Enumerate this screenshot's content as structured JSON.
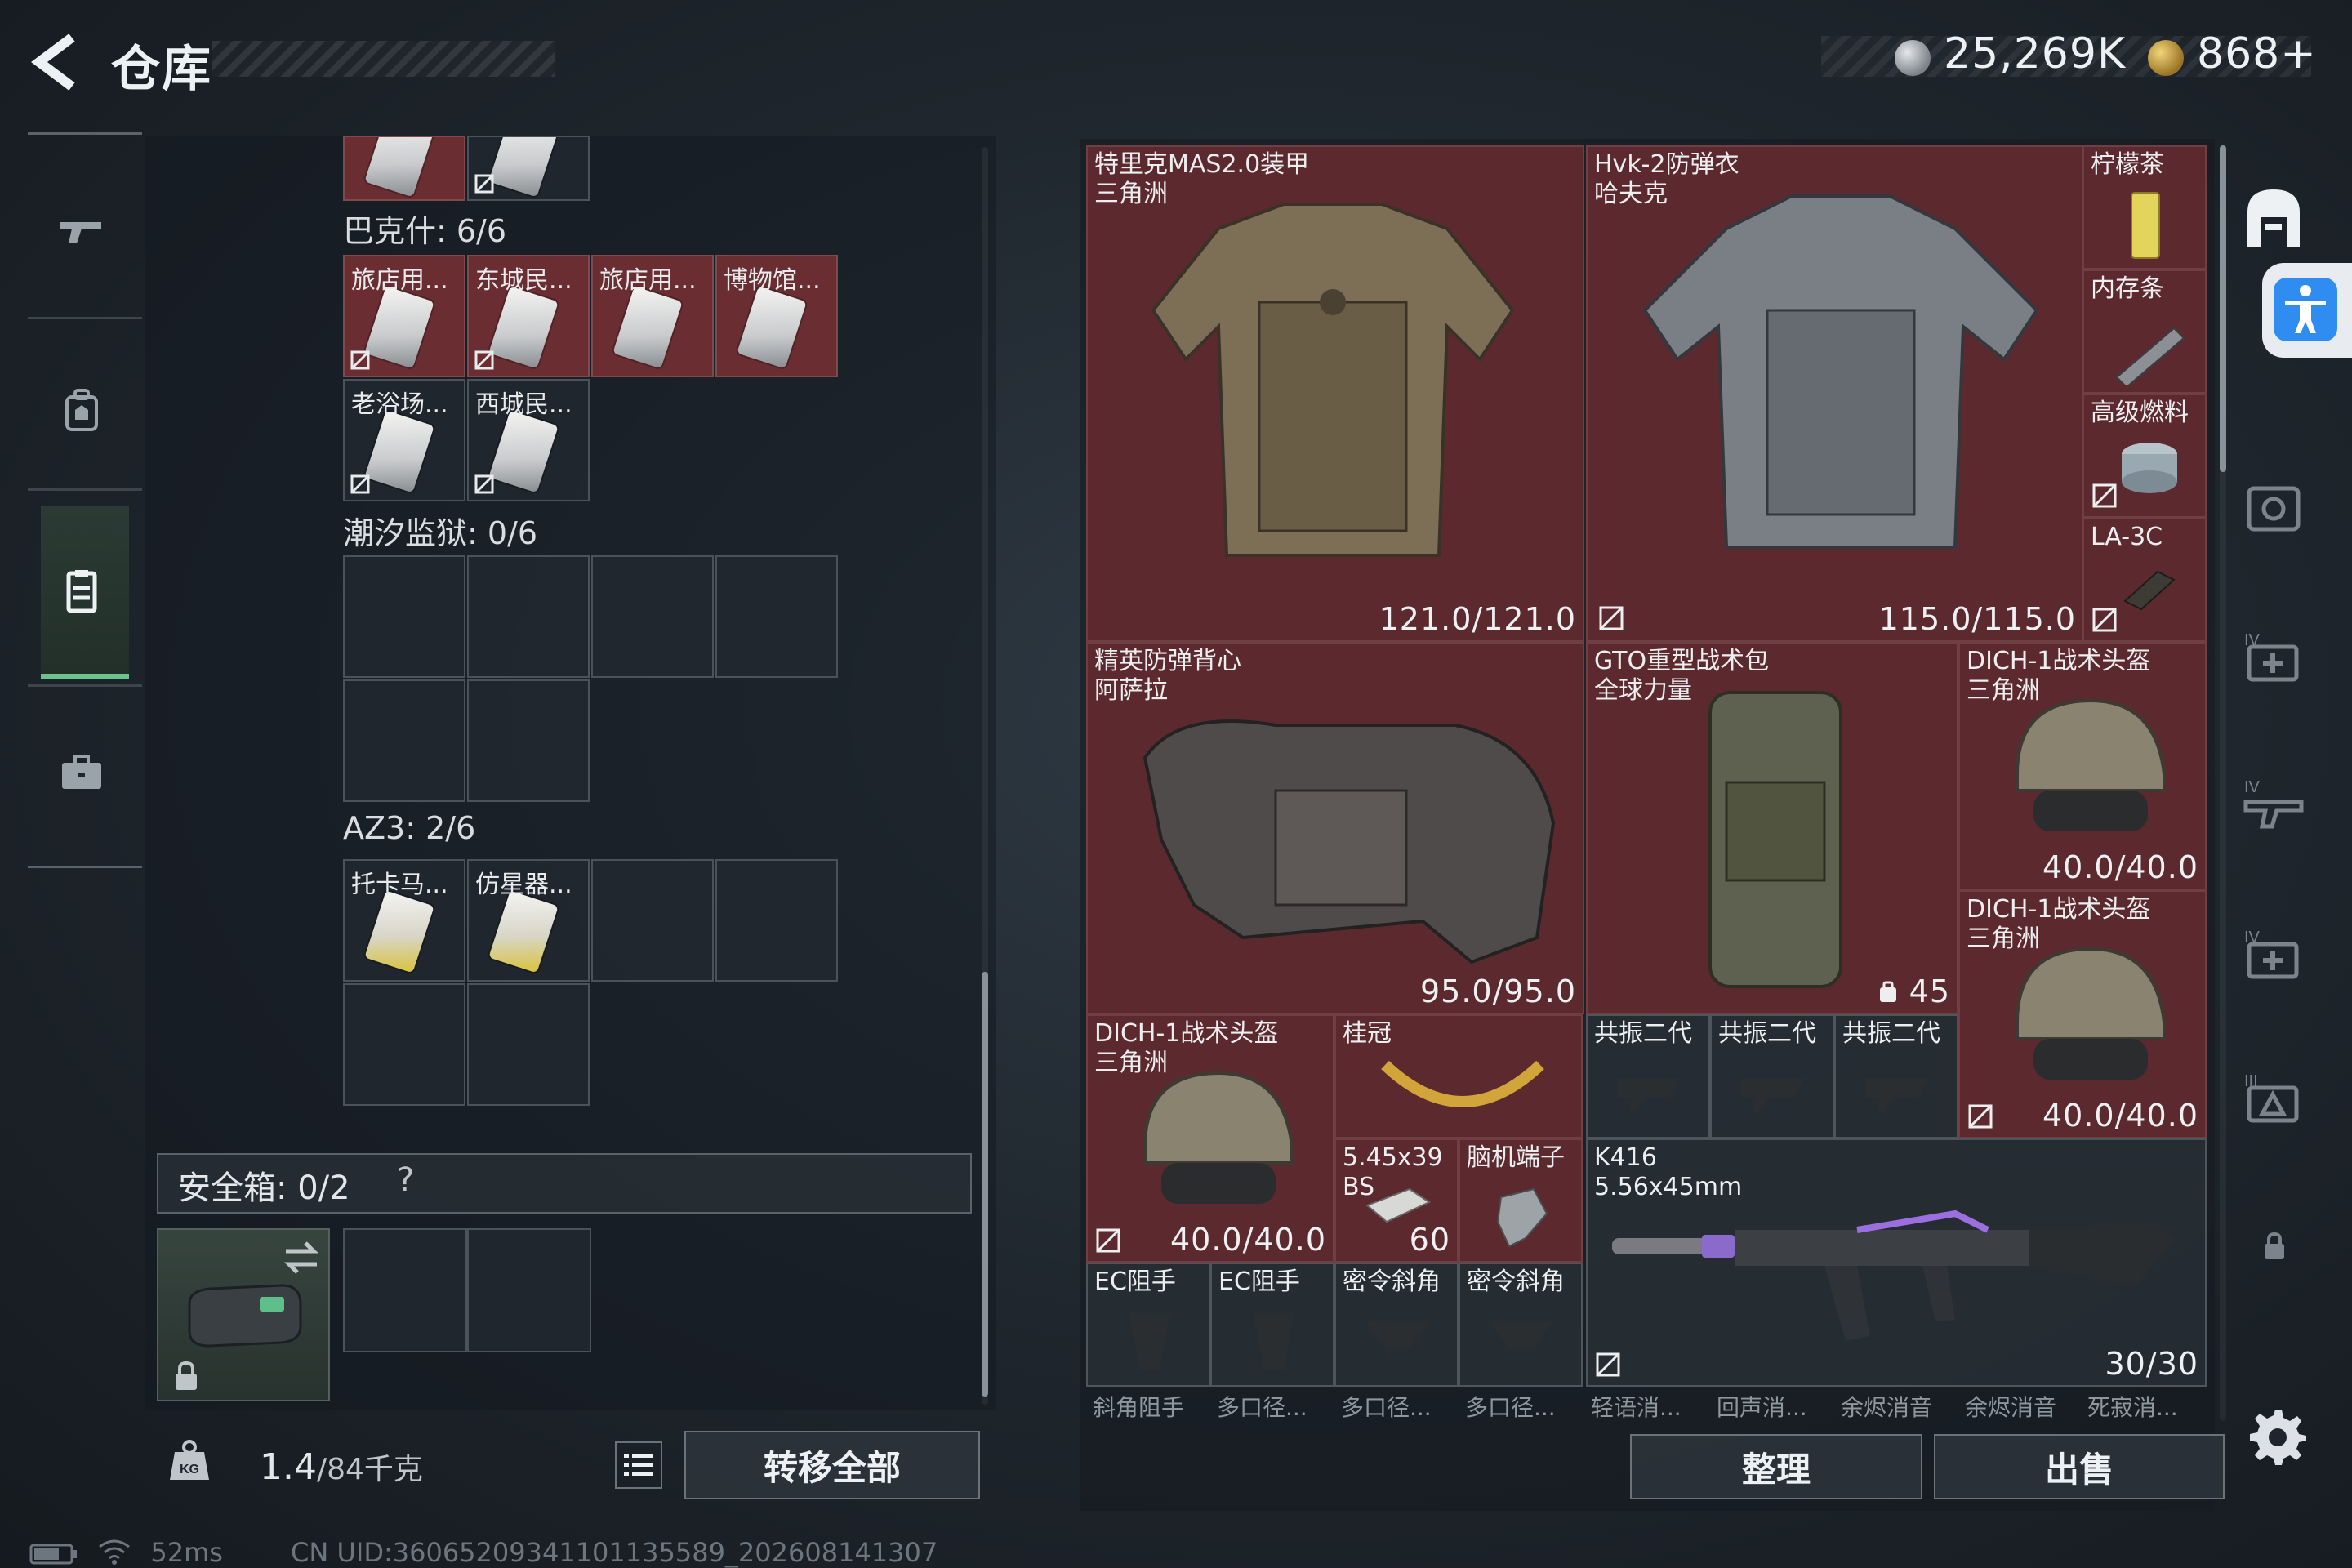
{
  "header": {
    "title": "仓库",
    "money": "25,269K",
    "coins": "868",
    "coins_plus": "+"
  },
  "left": {
    "sections": [
      {
        "label": "巴克什: 6/6"
      },
      {
        "label": "潮汐监狱: 0/6"
      },
      {
        "label": "AZ3: 2/6"
      }
    ],
    "bakshi_items": [
      "旅店用...",
      "东城民...",
      "旅店用...",
      "博物馆...",
      "老浴场...",
      "西城民..."
    ],
    "az3_items": [
      "托卡马...",
      "仿星器..."
    ],
    "safebox": {
      "label": "安全箱: 0/2",
      "help": "?"
    },
    "weight": {
      "value": "1.4",
      "capacity": "/84千克"
    },
    "transfer_label": "转移全部"
  },
  "stash": {
    "armor1": {
      "name": "特里克MAS2.0装甲\n三角洲",
      "durability": "121.0/121.0"
    },
    "armor2": {
      "name": "Hvk-2防弹衣\n哈夫克",
      "durability": "115.0/115.0"
    },
    "lemon_tea": {
      "name": "柠檬茶"
    },
    "ram": {
      "name": "内存条"
    },
    "fuel": {
      "name": "高级燃料"
    },
    "la3c": {
      "name": "LA-3C"
    },
    "vest": {
      "name": "精英防弹背心\n阿萨拉",
      "durability": "95.0/95.0"
    },
    "backpack": {
      "name": "GTO重型战术包\n全球力量",
      "capacity": "45"
    },
    "helmet1": {
      "name": "DICH-1战术头盔\n三角洲",
      "durability": "40.0/40.0"
    },
    "helmet2": {
      "name": "DICH-1战术头盔\n三角洲",
      "durability": "40.0/40.0"
    },
    "helmet3": {
      "name": "DICH-1战术头盔\n三角洲",
      "durability": "40.0/40.0"
    },
    "laurel": {
      "name": "桂冠"
    },
    "resonator1": {
      "name": "共振二代"
    },
    "resonator2": {
      "name": "共振二代"
    },
    "resonator3": {
      "name": "共振二代"
    },
    "ammo": {
      "name": "5.45x39\nBS",
      "count": "60"
    },
    "brain_terminal": {
      "name": "脑机端子"
    },
    "rifle": {
      "name": "K416\n5.56x45mm",
      "ammo": "30/30"
    },
    "ec_grip1": {
      "name": "EC阻手"
    },
    "ec_grip2": {
      "name": "EC阻手"
    },
    "angled_grip1": {
      "name": "密令斜角"
    },
    "angled_grip2": {
      "name": "密令斜角"
    },
    "bottom_row": [
      "斜角阻手",
      "多口径...",
      "多口径...",
      "多口径...",
      "轻语消...",
      "回声消...",
      "余烬消音",
      "余烬消音",
      "死寂消..."
    ],
    "sort_label": "整理",
    "sell_label": "出售"
  },
  "status": {
    "ping": "52ms",
    "uid": "CN UID:36065209341101135589_202608141307"
  },
  "colors": {
    "accent_green": "#6bc48b",
    "item_red": "#5c2a2e",
    "accessibility_blue": "#2f8cf0"
  }
}
